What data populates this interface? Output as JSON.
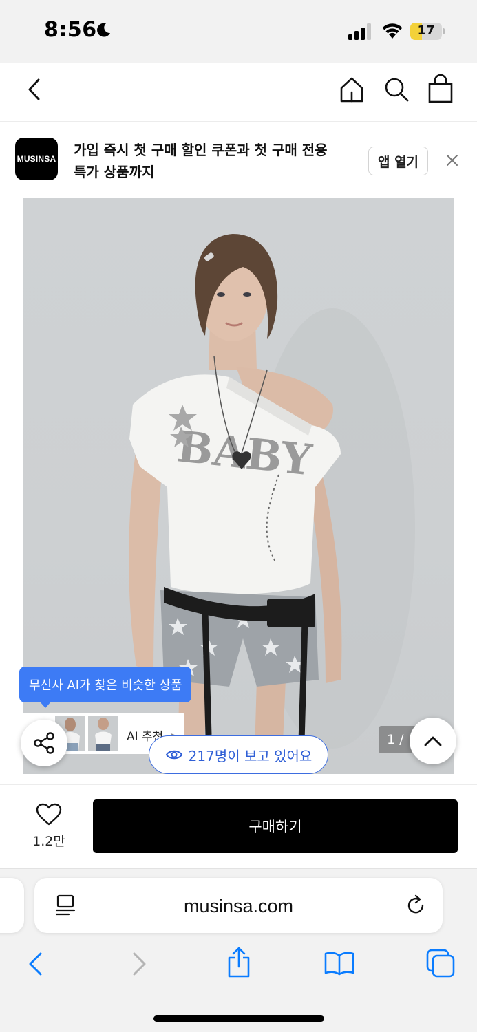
{
  "status_bar": {
    "time": "8:56",
    "battery_level": "17",
    "battery_fraction": 0.17
  },
  "banner": {
    "brand_logo_text": "MUSINSA",
    "line1": "가입 즉시 첫 구매 할인 쿠폰과 첫 구매 전용",
    "line2": "특가 상품까지",
    "open_app_label": "앱 열기"
  },
  "product": {
    "ai_tooltip": "무신사 AI가 찾은 비슷한 상품",
    "ai_recommend_label": "AI 추천",
    "ai_recommend_arrow": ">",
    "viewers_text": "217명이 보고 있어요",
    "page_indicator": "1 /"
  },
  "purchase": {
    "like_count": "1.2만",
    "buy_label": "구매하기"
  },
  "browser": {
    "url": "musinsa.com"
  },
  "icons": {
    "status": [
      "moon-icon",
      "signal-icon",
      "wifi-icon",
      "battery-icon"
    ],
    "nav": [
      "back-icon",
      "home-icon",
      "search-icon",
      "bag-icon"
    ],
    "browser": [
      "reader-icon",
      "reload-icon",
      "back-arrow-icon",
      "forward-arrow-icon",
      "share-icon",
      "bookmarks-icon",
      "tabs-icon"
    ]
  },
  "colors": {
    "accent_blue": "#3d7bf5",
    "buy_button": "#000000",
    "battery_low": "#f3d13a",
    "browser_blue": "#0a7cff"
  }
}
